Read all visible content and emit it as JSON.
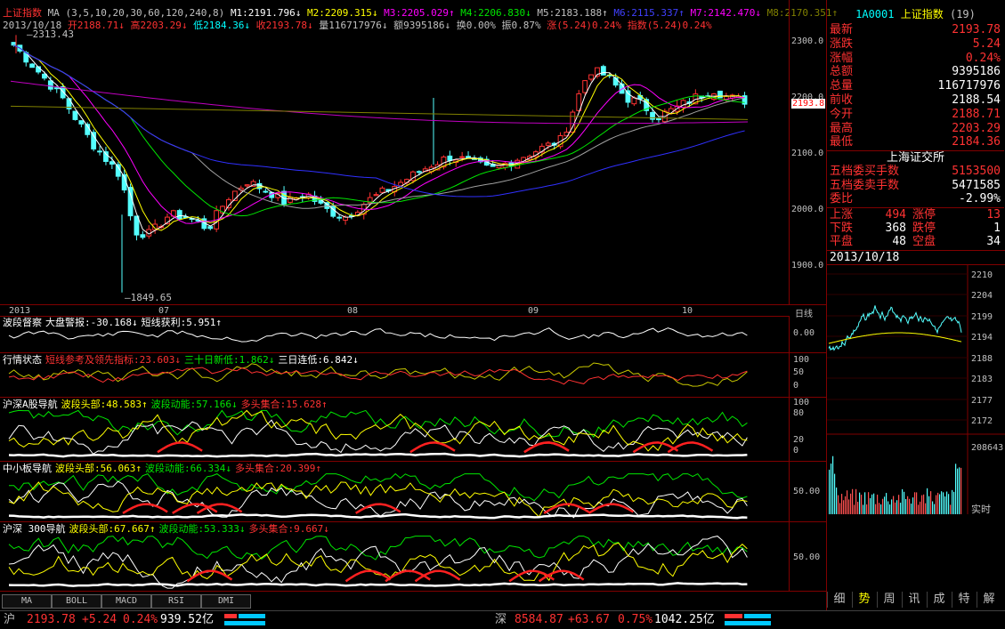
{
  "main": {
    "title": "上证指数",
    "ma_line": "MA (3,5,10,20,30,60,120,240,8)",
    "ma_items": [
      {
        "label": "M1:2191.796↓",
        "color": "#ffffff"
      },
      {
        "label": "M2:2209.315↓",
        "color": "#ffff00"
      },
      {
        "label": "M3:2205.029↑",
        "color": "#ff00ff"
      },
      {
        "label": "M4:2206.830↓",
        "color": "#00e600"
      },
      {
        "label": "M5:2183.188↑",
        "color": "#c0c0c0"
      },
      {
        "label": "M6:2115.337↑",
        "color": "#4040ff"
      },
      {
        "label": "M7:2142.470↓",
        "color": "#ff00ff"
      },
      {
        "label": "M8:2170.351↑",
        "color": "#808000"
      }
    ],
    "date": "2013/10/18",
    "quote_items": [
      {
        "label": "开2188.71↓",
        "color": "#ff3232"
      },
      {
        "label": "高2203.29↓",
        "color": "#ff3232"
      },
      {
        "label": "低2184.36↓",
        "color": "#00ffff"
      },
      {
        "label": "收2193.78↓",
        "color": "#ff3232"
      },
      {
        "label": "量116717976↓",
        "color": "#c0c0c0"
      },
      {
        "label": "额9395186↓",
        "color": "#c0c0c0"
      },
      {
        "label": "换0.00%",
        "color": "#c0c0c0"
      },
      {
        "label": "振0.87%",
        "color": "#c0c0c0"
      },
      {
        "label": "涨(5.24)0.24%",
        "color": "#ff3232"
      },
      {
        "label": "指数(5.24)0.24%",
        "color": "#ff3232"
      }
    ],
    "high_mark": "2313.43",
    "low_mark": "1849.65",
    "current_price_tag": "2193.8",
    "y_ticks": [
      "2300.0",
      "2200.0",
      "2100.0",
      "2000.0",
      "1900.0"
    ],
    "x_ticks": [
      "2013",
      "07",
      "08",
      "09",
      "10"
    ],
    "period": "日线"
  },
  "indicators": [
    {
      "name": "波段督察",
      "items": [
        {
          "label": "大盘警报:-30.168↓",
          "color": "#ffffff"
        },
        {
          "label": "短线获利:5.951↑",
          "color": "#ffffff"
        }
      ],
      "ticks": [
        "0.00"
      ]
    },
    {
      "name": "行情状态",
      "items": [
        {
          "label": "短线参考及领先指标:23.603↓",
          "color": "#ff3232"
        },
        {
          "label": "三十日新低:1.862↓",
          "color": "#00e600"
        },
        {
          "label": "三日连低:6.842↓",
          "color": "#ffffff"
        }
      ],
      "ticks": [
        "100",
        "50",
        "0"
      ]
    },
    {
      "name": "沪深A股导航",
      "items": [
        {
          "label": "波段头部:48.583↑",
          "color": "#ffff00"
        },
        {
          "label": "波段动能:57.166↓",
          "color": "#00e600"
        },
        {
          "label": "多头集合:15.628↑",
          "color": "#ff3232"
        }
      ],
      "ticks": [
        "100",
        "80",
        "20",
        "0"
      ]
    },
    {
      "name": "中小板导航",
      "items": [
        {
          "label": "波段头部:56.063↑",
          "color": "#ffff00"
        },
        {
          "label": "波段动能:66.334↓",
          "color": "#00e600"
        },
        {
          "label": "多头集合:20.399↑",
          "color": "#ff3232"
        }
      ],
      "ticks": [
        "50.00"
      ]
    },
    {
      "name": "沪深 300导航",
      "items": [
        {
          "label": "波段头部:67.667↑",
          "color": "#ffff00"
        },
        {
          "label": "波段动能:53.333↓",
          "color": "#00e600"
        },
        {
          "label": "多头集合:9.667↓",
          "color": "#ff3232"
        }
      ],
      "ticks": [
        "50.00"
      ]
    }
  ],
  "bottom_tabs": [
    "MA",
    "BOLL",
    "MACD",
    "RSI",
    "DMI"
  ],
  "quote_panel": {
    "header_code": "1A0001",
    "header_name": "上证指数",
    "header_count": "(19)",
    "rows": [
      {
        "k": "最新",
        "v": "2193.78",
        "c": "#ff3232"
      },
      {
        "k": "涨跌",
        "v": "5.24",
        "c": "#ff3232"
      },
      {
        "k": "涨幅",
        "v": "0.24%",
        "c": "#ff3232"
      },
      {
        "k": "总额",
        "v": "9395186",
        "c": "#ffffff"
      },
      {
        "k": "总量",
        "v": "116717976",
        "c": "#ffffff"
      },
      {
        "k": "前收",
        "v": "2188.54",
        "c": "#ffffff"
      },
      {
        "k": "今开",
        "v": "2188.71",
        "c": "#ff3232"
      },
      {
        "k": "最高",
        "v": "2203.29",
        "c": "#ff3232"
      },
      {
        "k": "最低",
        "v": "2184.36",
        "c": "#ff3232"
      }
    ],
    "exchange": "上海证交所",
    "order_rows": [
      {
        "k": "五档委买手数",
        "v": "5153500",
        "c": "#ff3232"
      },
      {
        "k": "五档委卖手数",
        "v": "5471585",
        "c": "#ffffff"
      },
      {
        "k": "委比",
        "v": "-2.99%",
        "c": "#ffffff"
      }
    ],
    "stats": [
      {
        "k1": "上涨",
        "v1": "494",
        "c1": "#ff3232",
        "k2": "涨停",
        "v2": "13",
        "c2": "#ff3232"
      },
      {
        "k1": "下跌",
        "v1": "368",
        "c1": "#ffffff",
        "k2": "跌停",
        "v2": "1",
        "c2": "#ffffff"
      },
      {
        "k1": "平盘",
        "v1": "48",
        "c1": "#ffffff",
        "k2": "空盘",
        "v2": "34",
        "c2": "#ffffff"
      }
    ],
    "mini_date": "2013/10/18",
    "mini_ticks": [
      "2210",
      "2204",
      "2199",
      "2194",
      "2188",
      "2183",
      "2177",
      "2172"
    ],
    "mini_vol": "208643",
    "mini_label": "实时",
    "tabs": [
      "细",
      "势",
      "周",
      "讯",
      "成",
      "特",
      "解"
    ]
  },
  "status_bar": {
    "sh_label": "沪",
    "sh_price": "2193.78",
    "sh_change": "+5.24",
    "sh_pct": "0.24%",
    "sh_amount": "939.52亿",
    "sz_label": "深",
    "sz_price": "8584.87",
    "sz_change": "+63.67",
    "sz_pct": "0.75%",
    "sz_amount": "1042.25亿"
  }
}
